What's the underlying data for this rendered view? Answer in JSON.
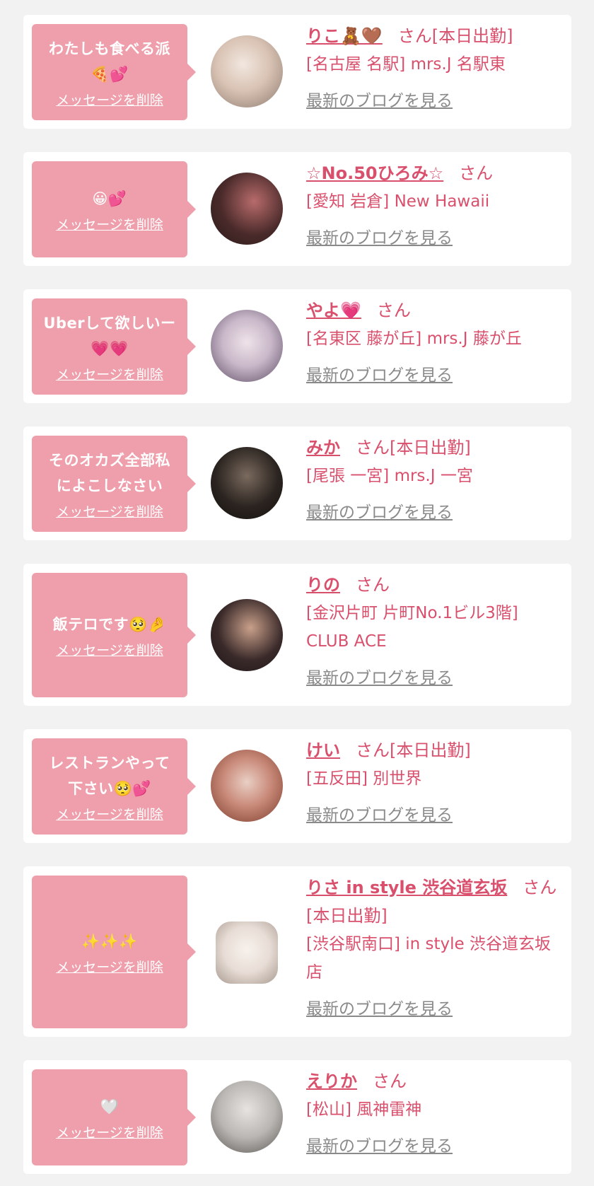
{
  "entries": [
    {
      "message": "わたしも食べる派\n🍕💕",
      "delete_label": "メッセージを削除",
      "name": "りこ🧸🤎",
      "honorific": "さん",
      "status": "[本日出勤]",
      "location": "[名古屋 名駅] mrs.J 名駅東",
      "blog_label": "最新のブログを見る",
      "avatar_colors": [
        "#d9c3b4",
        "#8c7a6f",
        "#f2e7df"
      ]
    },
    {
      "message": "😀💕",
      "delete_label": "メッセージを削除",
      "name": "☆No.50ひろみ☆",
      "honorific": "さん",
      "status": "",
      "location": "[愛知 岩倉] New Hawaii",
      "blog_label": "最新のブログを見る",
      "avatar_colors": [
        "#4a2a2a",
        "#b86b6b",
        "#2a1a1a"
      ]
    },
    {
      "message": "Uberして欲しいー\n💗💗",
      "delete_label": "メッセージを削除",
      "name": "やよ💗",
      "honorific": "さん",
      "status": "",
      "location": "[名東区 藤が丘] mrs.J 藤が丘",
      "blog_label": "最新のブログを見る",
      "avatar_colors": [
        "#c9b8c9",
        "#5a4a63",
        "#efe3ea"
      ]
    },
    {
      "message": "そのオカズ全部私\nによこしなさい",
      "delete_label": "メッセージを削除",
      "name": "みか",
      "honorific": "さん",
      "status": "[本日出勤]",
      "location": "[尾張 一宮] mrs.J 一宮",
      "blog_label": "最新のブログを見る",
      "avatar_colors": [
        "#2b2420",
        "#7a6a5e",
        "#161210"
      ]
    },
    {
      "message": "飯テロです🥺🤌",
      "delete_label": "メッセージを削除",
      "name": "りの",
      "honorific": "さん",
      "status": "",
      "location": "[金沢片町 片町No.1ビル3階] CLUB ACE",
      "blog_label": "最新のブログを見る",
      "avatar_colors": [
        "#3a2a2a",
        "#c9a08a",
        "#1c1414"
      ]
    },
    {
      "message": "レストランやって\n下さい🥺💕",
      "delete_label": "メッセージを削除",
      "name": "けい",
      "honorific": "さん",
      "status": "[本日出勤]",
      "location": "[五反田] 別世界",
      "blog_label": "最新のブログを見る",
      "avatar_colors": [
        "#c98a7a",
        "#7a3a2a",
        "#e9cfc4"
      ]
    },
    {
      "message": "✨✨✨",
      "delete_label": "メッセージを削除",
      "name": "りさ in style 渋谷道玄坂",
      "honorific": "さん",
      "status": "[本日出勤]",
      "location": "[渋谷駅南口] in style 渋谷道玄坂店",
      "blog_label": "最新のブログを見る",
      "avatar_colors": [
        "#e8ddd6",
        "#a79a90",
        "#f7f1ec"
      ]
    },
    {
      "message": "🤍",
      "delete_label": "メッセージを削除",
      "name": "えりか",
      "honorific": "さん",
      "status": "",
      "location": "[松山] 風神雷神",
      "blog_label": "最新のブログを見る",
      "avatar_colors": [
        "#b9b6b3",
        "#5a5652",
        "#e6e3e0"
      ]
    }
  ]
}
